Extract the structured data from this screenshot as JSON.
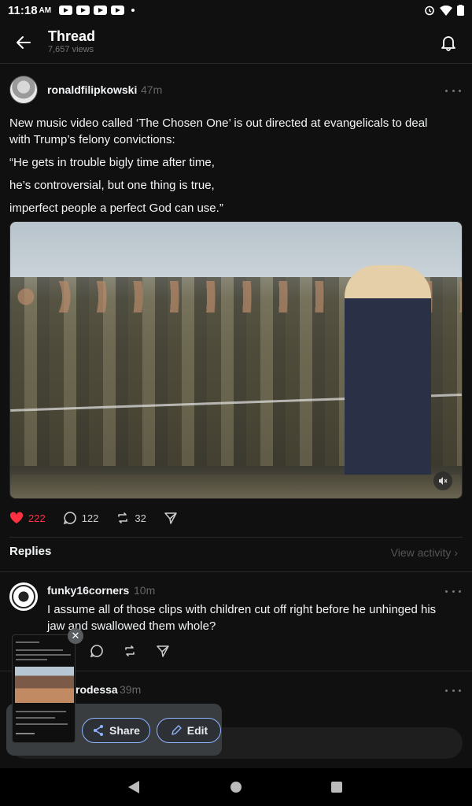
{
  "status_bar": {
    "time": "11:18",
    "ampm": "AM"
  },
  "header": {
    "title": "Thread",
    "views": "7,657 views"
  },
  "post": {
    "username": "ronaldfilipkowski",
    "time": "47m",
    "text_lines": [
      "New music video called ‘The Chosen One’ is out directed at evangelicals to deal with Trump’s felony convictions:",
      "“He gets in trouble bigly time after time,",
      "he’s controversial, but one thing is true,",
      "imperfect people a perfect God can use.”"
    ],
    "likes": "222",
    "comments": "122",
    "reposts": "32"
  },
  "replies_section": {
    "title": "Replies",
    "view_activity": "View activity"
  },
  "replies": [
    {
      "username": "funky16corners",
      "time": "10m",
      "text": "I assume all of those clips with children cut off right before he unhinged his jaw and swallowed them whole?"
    },
    {
      "username": "rodessa",
      "time": "39m"
    }
  ],
  "screenshot_popup": {
    "share_label": "Share",
    "edit_label": "Edit",
    "close": "✕"
  },
  "colors": {
    "background": "#101010",
    "like": "#ff3040",
    "accent_border": "#8fb4ff"
  }
}
